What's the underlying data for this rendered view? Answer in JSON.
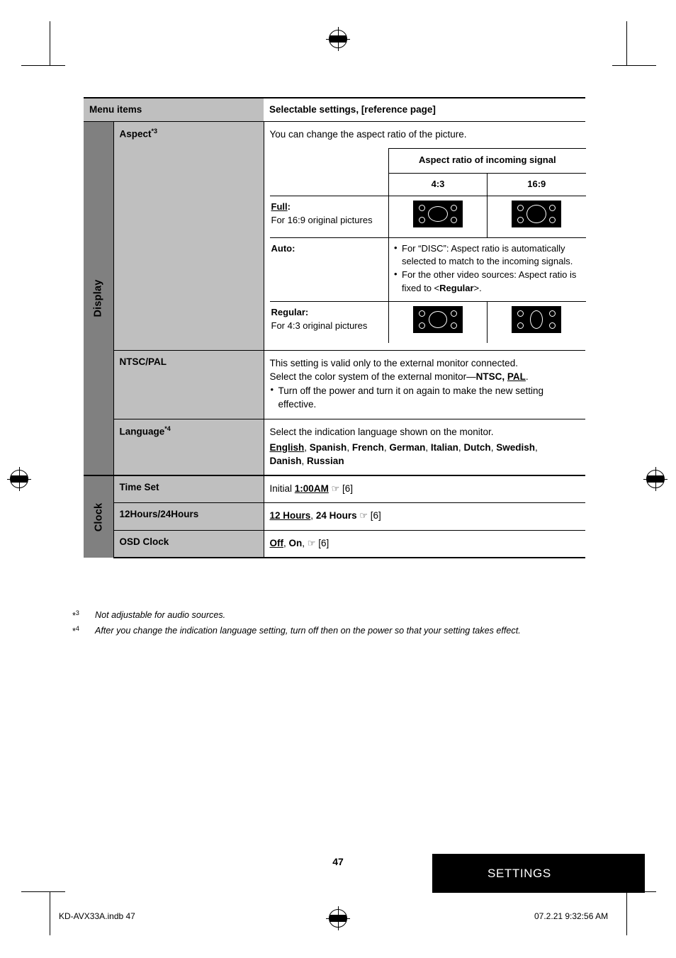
{
  "table": {
    "header": {
      "menu_items": "Menu items",
      "selectable": "Selectable settings, [reference page]"
    },
    "categories": {
      "display": "Display",
      "clock": "Clock"
    },
    "rows": [
      {
        "item": "Aspect",
        "item_sup": "*3",
        "intro": "You can change the aspect ratio of the picture.",
        "aspect_table": {
          "header": "Aspect ratio of incoming signal",
          "col_43": "4:3",
          "col_169": "16:9",
          "full_label": "Full",
          "full_colon": ":",
          "full_desc": "For 16:9 original pictures",
          "auto_label": "Auto",
          "auto_colon": ":",
          "auto_bullets": [
            "For “DISC”: Aspect ratio is automatically selected to match to the incoming signals.",
            "For the other video sources: Aspect ratio is fixed to <Regular>."
          ],
          "auto_bullet2_pre": "For the other video sources: Aspect ratio is fixed to <",
          "auto_bullet2_bold": "Regular",
          "auto_bullet2_post": ">.",
          "regular_label": "Regular",
          "regular_colon": ":",
          "regular_desc": "For 4:3 original pictures"
        }
      },
      {
        "item": "NTSC/PAL",
        "line1": "This setting is valid only to the external monitor connected.",
        "line2_pre": "Select the color system of the external monitor—",
        "line2_bold1": "NTSC,",
        "line2_bold2": "PAL",
        "line2_post": ".",
        "bullet": "Turn off the power and turn it on again to make the new setting effective."
      },
      {
        "item": "Language",
        "item_sup": "*4",
        "line1": "Select the indication language shown on the monitor.",
        "languages": [
          "English",
          "Spanish",
          "French",
          "German",
          "Italian",
          "Dutch",
          "Swedish",
          "Danish",
          "Russian"
        ]
      },
      {
        "item": "Time Set",
        "initial_word": "Initial",
        "value": "1:00AM",
        "ref": "[6]"
      },
      {
        "item": "12Hours/24Hours",
        "value1": "12 Hours",
        "value2": "24 Hours",
        "ref": "[6]"
      },
      {
        "item": "OSD Clock",
        "value1": "Off",
        "value2": "On",
        "ref": "[6]"
      }
    ]
  },
  "footnotes": [
    {
      "mark": "*3",
      "text": "Not adjustable for audio sources."
    },
    {
      "mark": "*4",
      "text": "After you change the indication language setting, turn off then on the power so that your setting takes effect."
    }
  ],
  "footer": {
    "page_number": "47",
    "banner": "SETTINGS",
    "file_name": "KD-AVX33A.indb   47",
    "timestamp": "07.2.21   9:32:56 AM"
  }
}
